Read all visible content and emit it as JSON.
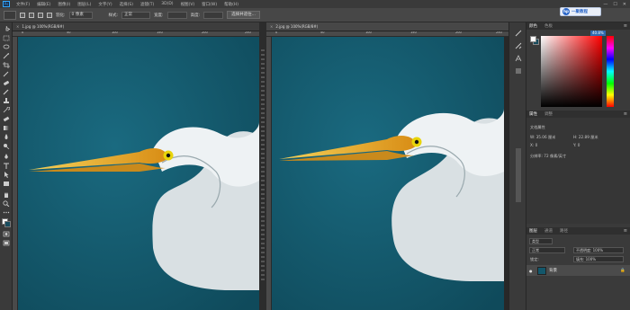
{
  "menubar": {
    "app_logo": "Ps",
    "items": [
      "文件(F)",
      "编辑(E)",
      "图像(I)",
      "图层(L)",
      "文字(Y)",
      "选择(S)",
      "滤镜(T)",
      "3D(D)",
      "视图(V)",
      "窗口(W)",
      "帮助(H)"
    ],
    "minimize": "—",
    "maximize": "☐",
    "close": "✕"
  },
  "watermark": {
    "logo": "hp",
    "text": "一聚教程"
  },
  "options": {
    "feather_label": "羽化:",
    "feather_value": "0 像素",
    "style_label": "样式:",
    "style_value": "正常",
    "width_label": "宽度:",
    "height_label": "高度:",
    "select_mask": "选择并遮住..."
  },
  "documents": [
    {
      "tab": "1.jpg @ 100%(RGB/8#)",
      "close": "×",
      "ruler_labels": [
        "0",
        "50",
        "100",
        "150",
        "200",
        "250"
      ]
    },
    {
      "tab": "2.jpg @ 100%(RGB/8#)",
      "close": "×",
      "ruler_labels": [
        "0",
        "50",
        "100",
        "150",
        "200",
        "250"
      ]
    }
  ],
  "panels": {
    "color_tabs": [
      "颜色",
      "色板"
    ],
    "color_readout": "40.8%",
    "properties_tabs": [
      "属性",
      "调整"
    ],
    "properties_title": "文档属性",
    "prop_w": "W: 35.06 厘米",
    "prop_h": "H: 22.89 厘米",
    "prop_x": "X: 0",
    "prop_y": "Y: 0",
    "prop_resolution": "分辨率: 72 像素/英寸",
    "layers_tabs": [
      "图层",
      "通道",
      "路径"
    ],
    "layers_kind": "类型",
    "layers_mode": "正常",
    "layers_opacity": "不透明度: 100%",
    "layers_fill": "填充: 100%",
    "layers_lock": "锁定:",
    "layer_name": "背景",
    "layer_lock_icon": "🔒",
    "menu_icon": "≡"
  },
  "colors": {
    "water": "#13576b",
    "bird": "#e4eaed",
    "beak": "#e8a41c",
    "eye": "#f2d60a"
  }
}
